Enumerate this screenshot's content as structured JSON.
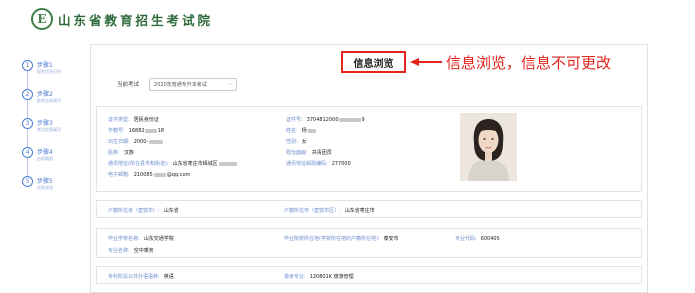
{
  "header": {
    "logo_letter": "E",
    "site_title": "山东省教育招生考试院"
  },
  "steps": [
    {
      "num": "1",
      "name": "步骤1",
      "desc": "报考信息识别"
    },
    {
      "num": "2",
      "name": "步骤2",
      "desc": "报考信息填写"
    },
    {
      "num": "3",
      "name": "步骤3",
      "desc": "考试信息填写"
    },
    {
      "num": "4",
      "name": "步骤4",
      "desc": "志愿填报"
    },
    {
      "num": "5",
      "name": "步骤5",
      "desc": "信息浏览"
    }
  ],
  "tab": {
    "label": "信息浏览"
  },
  "annotation": {
    "text": "信息浏览，信息不可更改",
    "color": "#e2241c"
  },
  "exam": {
    "label": "当前考试",
    "selected": "2020年普通专升本考试"
  },
  "personal": {
    "id_type": {
      "label": "证件类型:",
      "value": "居民身份证"
    },
    "id_number": {
      "label": "证件号:",
      "value": "3704812000",
      "tail": "9"
    },
    "student_no": {
      "label": "学籍号:",
      "value": "16882",
      "tail": "18"
    },
    "name": {
      "label": "姓名:",
      "value": "杨"
    },
    "birth": {
      "label": "出生日期:",
      "value": "2000-"
    },
    "gender": {
      "label": "性别:",
      "value": "女"
    },
    "ethnicity": {
      "label": "民族:",
      "value": "汉族"
    },
    "politics": {
      "label": "政治面貌:",
      "value": "共青团员"
    },
    "address": {
      "label": "通讯地址(所在县市和街道):",
      "value": "山东省枣庄市峄城区"
    },
    "postcode": {
      "label": "通讯地址邮政编码:",
      "value": "277000"
    },
    "email": {
      "label": "电子邮箱:",
      "value": "210085",
      "tail": "@qq.com"
    }
  },
  "household": {
    "province": {
      "label": "户籍所在省（直辖市）:",
      "value": "山东省"
    },
    "city": {
      "label": "户籍所在市（直辖市区）:",
      "value": "山东省枣庄市"
    }
  },
  "school": {
    "graduate_school": {
      "label": "毕业学校名称:",
      "value": "山东交通学院"
    },
    "school_city": {
      "label": "毕业院校所在地(学校所在地的户籍所在地):",
      "value": "泰安市"
    },
    "major_code": {
      "label": "专业代码:",
      "value": "600405"
    },
    "major_name": {
      "label": "专业名称:",
      "value": "空中乘务"
    }
  },
  "apply": {
    "language": {
      "label": "专科阶段公共外语语种:",
      "value": "英语"
    },
    "major": {
      "label": "报考专业:",
      "value": "120801K 旅游管理"
    }
  }
}
